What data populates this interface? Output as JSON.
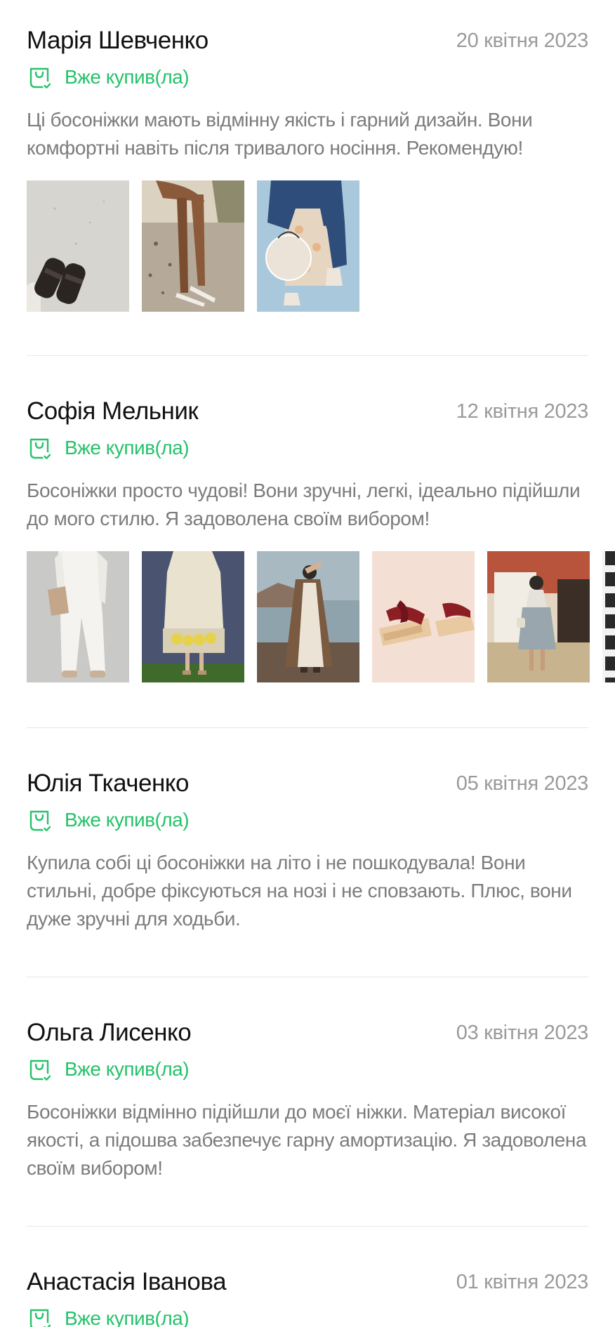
{
  "colors": {
    "accent_green": "#26c26b",
    "author_text": "#111111",
    "body_text": "#7c7c7c",
    "date_text": "#9a9a9a",
    "divider": "#e6e6e6"
  },
  "reviews": [
    {
      "author": "Марія Шевченко",
      "date": "20 квітня 2023",
      "badge_icon": "shopping-bag-check-icon",
      "badge": "Вже купив(ла)",
      "text": "Ці босоніжки мають відмінну якість і гарний дизайн. Вони комфортні навіть після тривалого носіння. Рекомендую!",
      "photos": [
        "photo-sandals-black-on-floor",
        "photo-legs-flat-sandals-on-rock",
        "photo-jeans-round-bag"
      ]
    },
    {
      "author": "Софія Мельник",
      "date": "12 квітня 2023",
      "badge_icon": "shopping-bag-check-icon",
      "badge": "Вже купив(ла)",
      "text": "Босоніжки просто чудові! Вони зручні, легкі, ідеально підійшли до мого стилю. Я задоволена своїм вибором!",
      "photos": [
        "photo-white-suit",
        "photo-lace-dress-lemons",
        "photo-woman-beach-cape",
        "photo-burgundy-platform-sandals",
        "photo-woman-street-skirt",
        "photo-striped-partial"
      ]
    },
    {
      "author": "Юлія Ткаченко",
      "date": "05 квітня 2023",
      "badge_icon": "shopping-bag-check-icon",
      "badge": "Вже купив(ла)",
      "text": "Купила собі ці босоніжки на літо і не пошкодувала! Вони стильні, добре фіксуються на нозі і не сповзають. Плюс, вони дуже зручні для ходьби.",
      "photos": []
    },
    {
      "author": "Ольга Лисенко",
      "date": "03 квітня 2023",
      "badge_icon": "shopping-bag-check-icon",
      "badge": "Вже купив(ла)",
      "text": "Босоніжки відмінно підійшли до моєї ніжки. Матеріал високої якості, а підошва забезпечує гарну амортизацію. Я задоволена своїм вибором!",
      "photos": []
    },
    {
      "author": "Анастасія Іванова",
      "date": "01 квітня 2023",
      "badge_icon": "shopping-bag-check-icon",
      "badge": "Вже купив(ла)",
      "text": "",
      "photos": []
    }
  ]
}
